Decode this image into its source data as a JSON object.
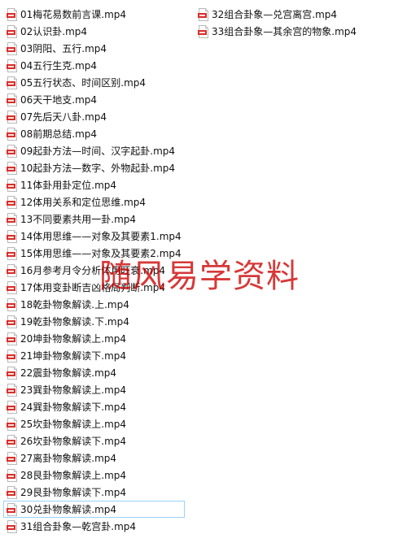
{
  "files_left": [
    "01梅花易数前言课.mp4",
    "02认识卦.mp4",
    "03阴阳、五行.mp4",
    "04五行生克.mp4",
    "05五行状态、时间区别.mp4",
    "06天干地支.mp4",
    "07先后天八卦.mp4",
    "08前期总结.mp4",
    "09起卦方法—时间、汉字起卦.mp4",
    "10起卦方法—数字、外物起卦.mp4",
    "11体卦用卦定位.mp4",
    "12体用关系和定位思维.mp4",
    "13不同要素共用一卦.mp4",
    "14体用思维——对象及其要素1.mp4",
    "15体用思维——对象及其要素2.mp4",
    "16月参考月令分析体用旺衰.mp4",
    "17体用变卦断吉凶格局判断.mp4",
    "18乾卦物象解读.上.mp4",
    "19乾卦物象解读.下.mp4",
    "20坤卦物象解读上.mp4",
    "21坤卦物象解读下.mp4",
    "22震卦物象解读.mp4",
    "23巽卦物象解读上.mp4",
    "24巽卦物象解读下.mp4",
    "25坎卦物象解读上.mp4",
    "26坎卦物象解读下.mp4",
    "27离卦物象解读.mp4",
    "28艮卦物象解读上.mp4",
    "29艮卦物象解读下.mp4",
    "30兑卦物象解读.mp4",
    "31组合卦象—乾宫卦.mp4"
  ],
  "files_right": [
    "32组合卦象—兑宫离宫.mp4",
    "33组合卦象—其余宫的物象.mp4"
  ],
  "selected_file": "30兑卦物象解读.mp4",
  "icon": "video-file-icon",
  "watermark": "随风易学资料",
  "colors": {
    "icon_red": "#d9302c",
    "selection_border": "#99d1ff",
    "watermark": "#cc0000"
  }
}
